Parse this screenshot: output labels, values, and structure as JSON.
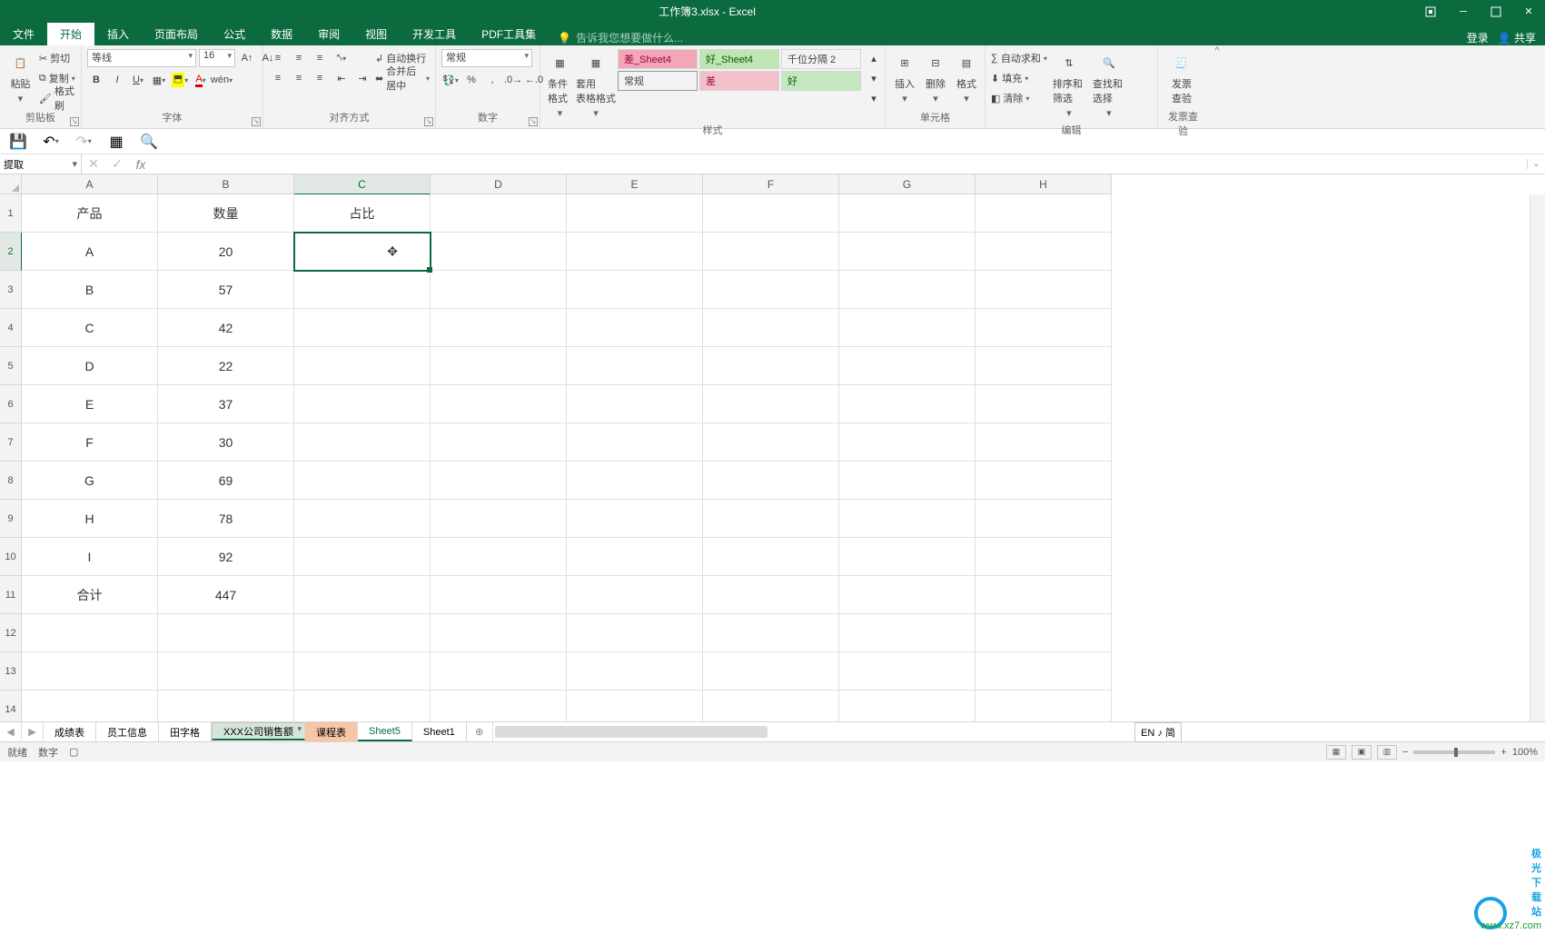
{
  "title": {
    "filename": "工作簿3.xlsx",
    "app": "Excel"
  },
  "actions": {
    "login": "登录",
    "share": "共享"
  },
  "tabs": {
    "file": "文件",
    "list": [
      "开始",
      "插入",
      "页面布局",
      "公式",
      "数据",
      "审阅",
      "视图",
      "开发工具",
      "PDF工具集"
    ],
    "tellme": "告诉我您想要做什么..."
  },
  "ribbon": {
    "clipboard": {
      "label": "剪贴板",
      "paste": "粘贴",
      "cut": "剪切",
      "copy": "复制",
      "painter": "格式刷"
    },
    "font": {
      "label": "字体",
      "name": "等线",
      "size": "16"
    },
    "align": {
      "label": "对齐方式",
      "wrap": "自动换行",
      "merge": "合并后居中"
    },
    "number": {
      "label": "数字",
      "format": "常规"
    },
    "styles": {
      "label": "样式",
      "condfmt": "条件格式",
      "tablefmt": "套用\n表格格式",
      "gallery": [
        {
          "text": "差_Sheet4",
          "bg": "#f2a6b8",
          "fg": "#9c0040"
        },
        {
          "text": "好_Sheet4",
          "bg": "#bfe5b3",
          "fg": "#006100"
        },
        {
          "text": "千位分隔 2",
          "bg": "#ffffff",
          "fg": "#333"
        },
        {
          "text": "常规",
          "bg": "#ffffff",
          "fg": "#333"
        },
        {
          "text": "差",
          "bg": "#f2c0cb",
          "fg": "#9c0040"
        },
        {
          "text": "好",
          "bg": "#c6e8c0",
          "fg": "#006100"
        }
      ]
    },
    "cells": {
      "label": "单元格",
      "insert": "插入",
      "delete": "删除",
      "format": "格式"
    },
    "editing": {
      "label": "编辑",
      "autosum": "自动求和",
      "fill": "填充",
      "clear": "清除",
      "sort": "排序和筛选",
      "find": "查找和选择"
    },
    "invoice": {
      "label": "发票查验",
      "btn": "发票\n查验"
    }
  },
  "formulabar": {
    "name": "提取",
    "value": ""
  },
  "columns": [
    "A",
    "B",
    "C",
    "D",
    "E",
    "F",
    "G",
    "H"
  ],
  "rows": [
    1,
    2,
    3,
    4,
    5,
    6,
    7,
    8,
    9,
    10,
    11,
    12,
    13,
    14
  ],
  "active_cell": "C2",
  "table": {
    "headers": [
      "产品",
      "数量",
      "占比"
    ],
    "data": [
      [
        "A",
        "20",
        ""
      ],
      [
        "B",
        "57",
        ""
      ],
      [
        "C",
        "42",
        ""
      ],
      [
        "D",
        "22",
        ""
      ],
      [
        "E",
        "37",
        ""
      ],
      [
        "F",
        "30",
        ""
      ],
      [
        "G",
        "69",
        ""
      ],
      [
        "H",
        "78",
        ""
      ],
      [
        "I",
        "92",
        ""
      ],
      [
        "合计",
        "447",
        ""
      ]
    ]
  },
  "sheets": {
    "list": [
      {
        "name": "成绩表",
        "state": ""
      },
      {
        "name": "员工信息",
        "state": ""
      },
      {
        "name": "田字格",
        "state": ""
      },
      {
        "name": "XXX公司销售额",
        "state": "sel"
      },
      {
        "name": "课程表",
        "state": "hl"
      },
      {
        "name": "Sheet5",
        "state": "active"
      },
      {
        "name": "Sheet1",
        "state": ""
      }
    ]
  },
  "ime": "EN ♪ 简",
  "status": {
    "ready": "就绪",
    "mode": "数字",
    "zoom": "100%"
  },
  "watermark": {
    "site": "www.xz7.com",
    "brand": "极光下载站"
  }
}
